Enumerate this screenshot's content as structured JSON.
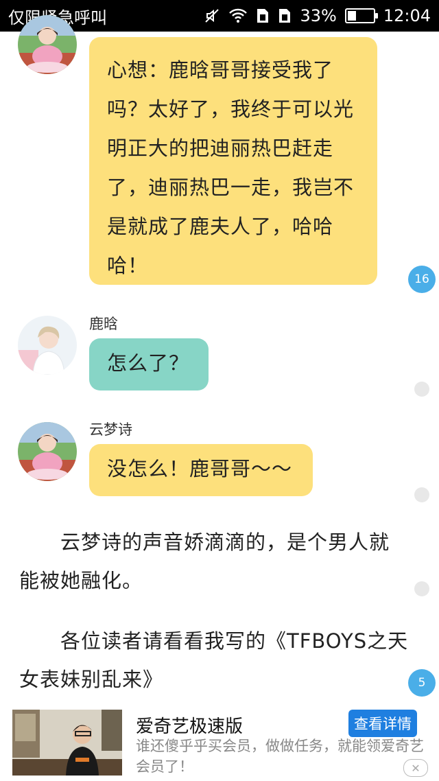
{
  "status_bar": {
    "carrier_text": "仅限紧急呼叫",
    "battery_percent": "33%",
    "battery_level": 0.33,
    "time": "12:04",
    "icons": [
      "mute-icon",
      "wifi-icon",
      "sim1-icon",
      "sim2-icon",
      "battery-icon"
    ]
  },
  "messages": [
    {
      "sender": "",
      "text_lines": [
        "心想：鹿晗哥哥接受我了",
        "吗？太好了，我终于可以光",
        "明正大的把迪丽热巴赶走",
        "了，迪丽热巴一走，我岂不",
        "是就成了鹿夫人了，哈哈",
        "哈！"
      ],
      "badge": "16"
    },
    {
      "sender": "鹿晗",
      "text": "怎么了？"
    },
    {
      "sender": "云梦诗",
      "text": "没怎么！鹿哥哥～～"
    }
  ],
  "paragraphs": [
    {
      "lines": [
        "　　云梦诗的声音娇滴滴的，是个男人就",
        "能被她融化。"
      ]
    },
    {
      "lines": [
        "　　各位读者请看看我写的《TFBOYS之天",
        "女表妹别乱来》"
      ],
      "badge": "5"
    }
  ],
  "ad": {
    "title": "爱奇艺极速版",
    "button": "查看详情",
    "description": "谁还傻乎乎买会员，做做任务，就能领爱奇艺会员了！",
    "close_icon": "close-icon"
  },
  "colors": {
    "yellow_bubble": "#fde07c",
    "teal_bubble": "#87d5c6",
    "badge": "#4aaee8",
    "ad_button": "#1f7fe0"
  }
}
